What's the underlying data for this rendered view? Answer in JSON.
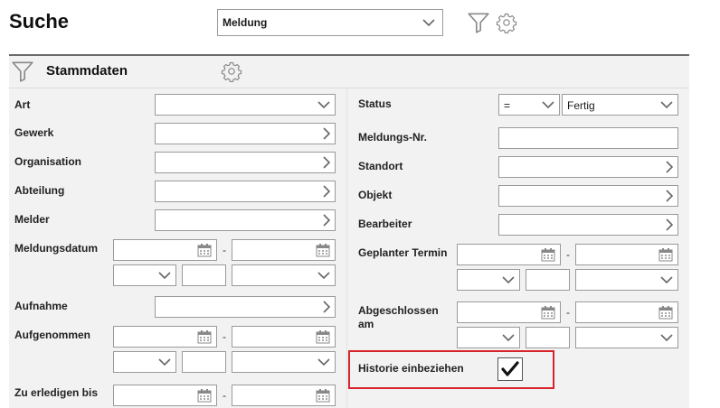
{
  "header": {
    "title": "Suche",
    "type_select": {
      "value": "Meldung"
    }
  },
  "section": {
    "title": "Stammdaten"
  },
  "left": {
    "art": "Art",
    "gewerk": "Gewerk",
    "organisation": "Organisation",
    "abteilung": "Abteilung",
    "melder": "Melder",
    "meldungsdatum": "Meldungsdatum",
    "aufnahme": "Aufnahme",
    "aufgenommen": "Aufgenommen",
    "zu_erledigen_bis": "Zu erledigen bis"
  },
  "right": {
    "status": "Status",
    "status_operator": "=",
    "status_value": "Fertig",
    "meldungs_nr": "Meldungs-Nr.",
    "standort": "Standort",
    "objekt": "Objekt",
    "bearbeiter": "Bearbeiter",
    "geplanter_termin": "Geplanter Termin",
    "abgeschlossen_line1": "Abgeschlossen",
    "abgeschlossen_line2": "am",
    "historie": "Historie einbeziehen",
    "historie_checked": true
  },
  "range_separator": "-",
  "icons": [
    "filter-icon",
    "gear-icon",
    "chevron-down-icon",
    "chevron-right-icon",
    "calendar-icon",
    "checkmark-icon"
  ],
  "colors": {
    "highlight": "#d8232a",
    "panel": "#f2f2f2"
  }
}
